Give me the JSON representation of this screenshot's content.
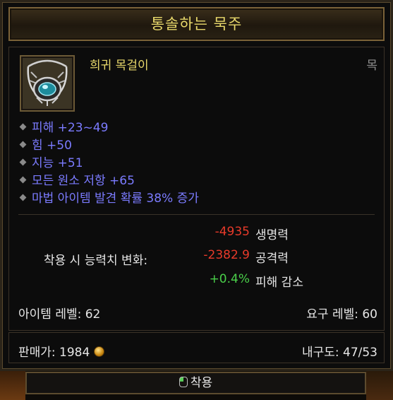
{
  "title": "통솔하는 묵주",
  "item": {
    "rarity_type": "희귀 목걸이",
    "slot": "목",
    "icon": "amulet-icon"
  },
  "affixes": [
    "피해 +23~49",
    "힘 +50",
    "지능 +51",
    "모든 원소 저항 +65",
    "마법 아이템 발견 확률 38% 증가"
  ],
  "stat_change": {
    "label": "착용 시 능력치 변화:",
    "rows": [
      {
        "value": "-4935",
        "name": "생명력",
        "color": "#e83a2a"
      },
      {
        "value": "-2382.9",
        "name": "공격력",
        "color": "#e83a2a"
      },
      {
        "value": "+0.4%",
        "name": "피해 감소",
        "color": "#4ad04a"
      }
    ]
  },
  "item_level": "아이템 레벨: 62",
  "required_level": "요구 레벨: 60",
  "sell_price": "판매가: 1984",
  "durability_label": "내구도:",
  "durability_value": "47/53",
  "action": {
    "label": "착용",
    "icon": "mouse-icon"
  },
  "colors": {
    "title": "#e8d86b",
    "affix": "#7b7bff",
    "loss": "#e83a2a",
    "gain": "#4ad04a"
  }
}
